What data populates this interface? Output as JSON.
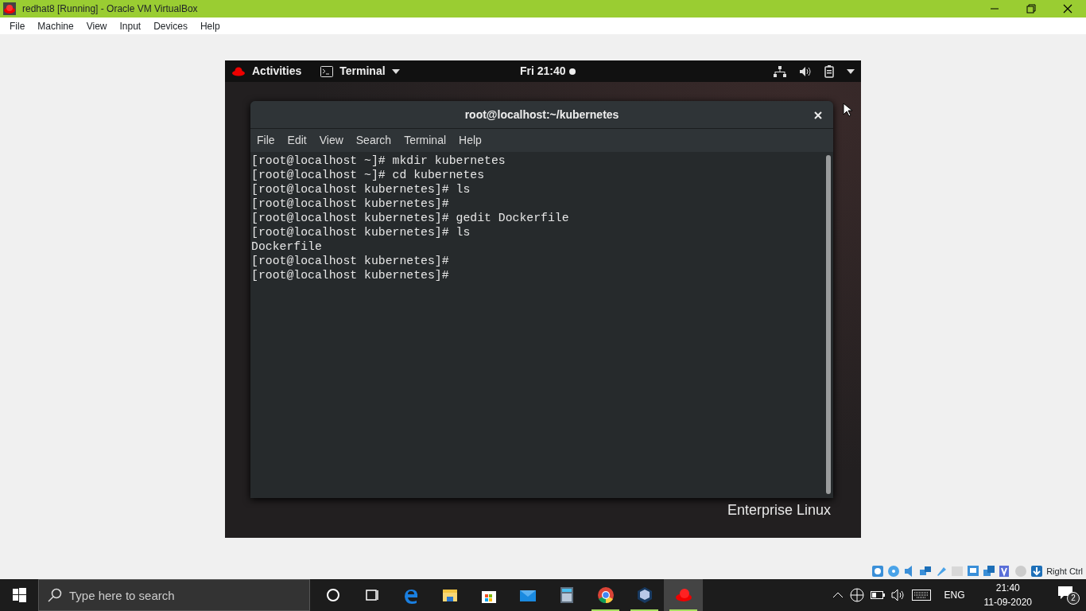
{
  "window": {
    "title": "redhat8 [Running] - Oracle VM VirtualBox"
  },
  "menu": [
    "File",
    "Machine",
    "View",
    "Input",
    "Devices",
    "Help"
  ],
  "guest": {
    "activities": "Activities",
    "app_menu": "Terminal",
    "clock": "Fri 21:40",
    "terminal": {
      "title": "root@localhost:~/kubernetes",
      "menu": [
        "File",
        "Edit",
        "View",
        "Search",
        "Terminal",
        "Help"
      ],
      "lines": [
        "[root@localhost ~]# mkdir kubernetes",
        "[root@localhost ~]# cd kubernetes",
        "[root@localhost kubernetes]# ls",
        "[root@localhost kubernetes]#",
        "[root@localhost kubernetes]# gedit Dockerfile",
        "[root@localhost kubernetes]# ls",
        "Dockerfile",
        "[root@localhost kubernetes]#",
        "[root@localhost kubernetes]#"
      ]
    },
    "wallpaper_text": "Enterprise Linux"
  },
  "status_bar": {
    "host_key": "Right Ctrl"
  },
  "taskbar": {
    "search": {
      "placeholder": "Type here to search"
    },
    "apps": [
      {
        "kind": "cortana",
        "running": false,
        "selected": false
      },
      {
        "kind": "taskview",
        "running": false,
        "selected": false
      },
      {
        "kind": "edge",
        "running": false,
        "selected": false
      },
      {
        "kind": "explorer",
        "running": false,
        "selected": false
      },
      {
        "kind": "store",
        "running": false,
        "selected": false
      },
      {
        "kind": "mail",
        "running": false,
        "selected": false
      },
      {
        "kind": "calculator",
        "running": false,
        "selected": false
      },
      {
        "kind": "chrome",
        "running": true,
        "selected": false
      },
      {
        "kind": "virtualbox",
        "running": true,
        "selected": false
      },
      {
        "kind": "redhat",
        "running": true,
        "selected": true
      }
    ],
    "language": "ENG",
    "time": "21:40",
    "date": "11-09-2020",
    "notifications": "2"
  }
}
